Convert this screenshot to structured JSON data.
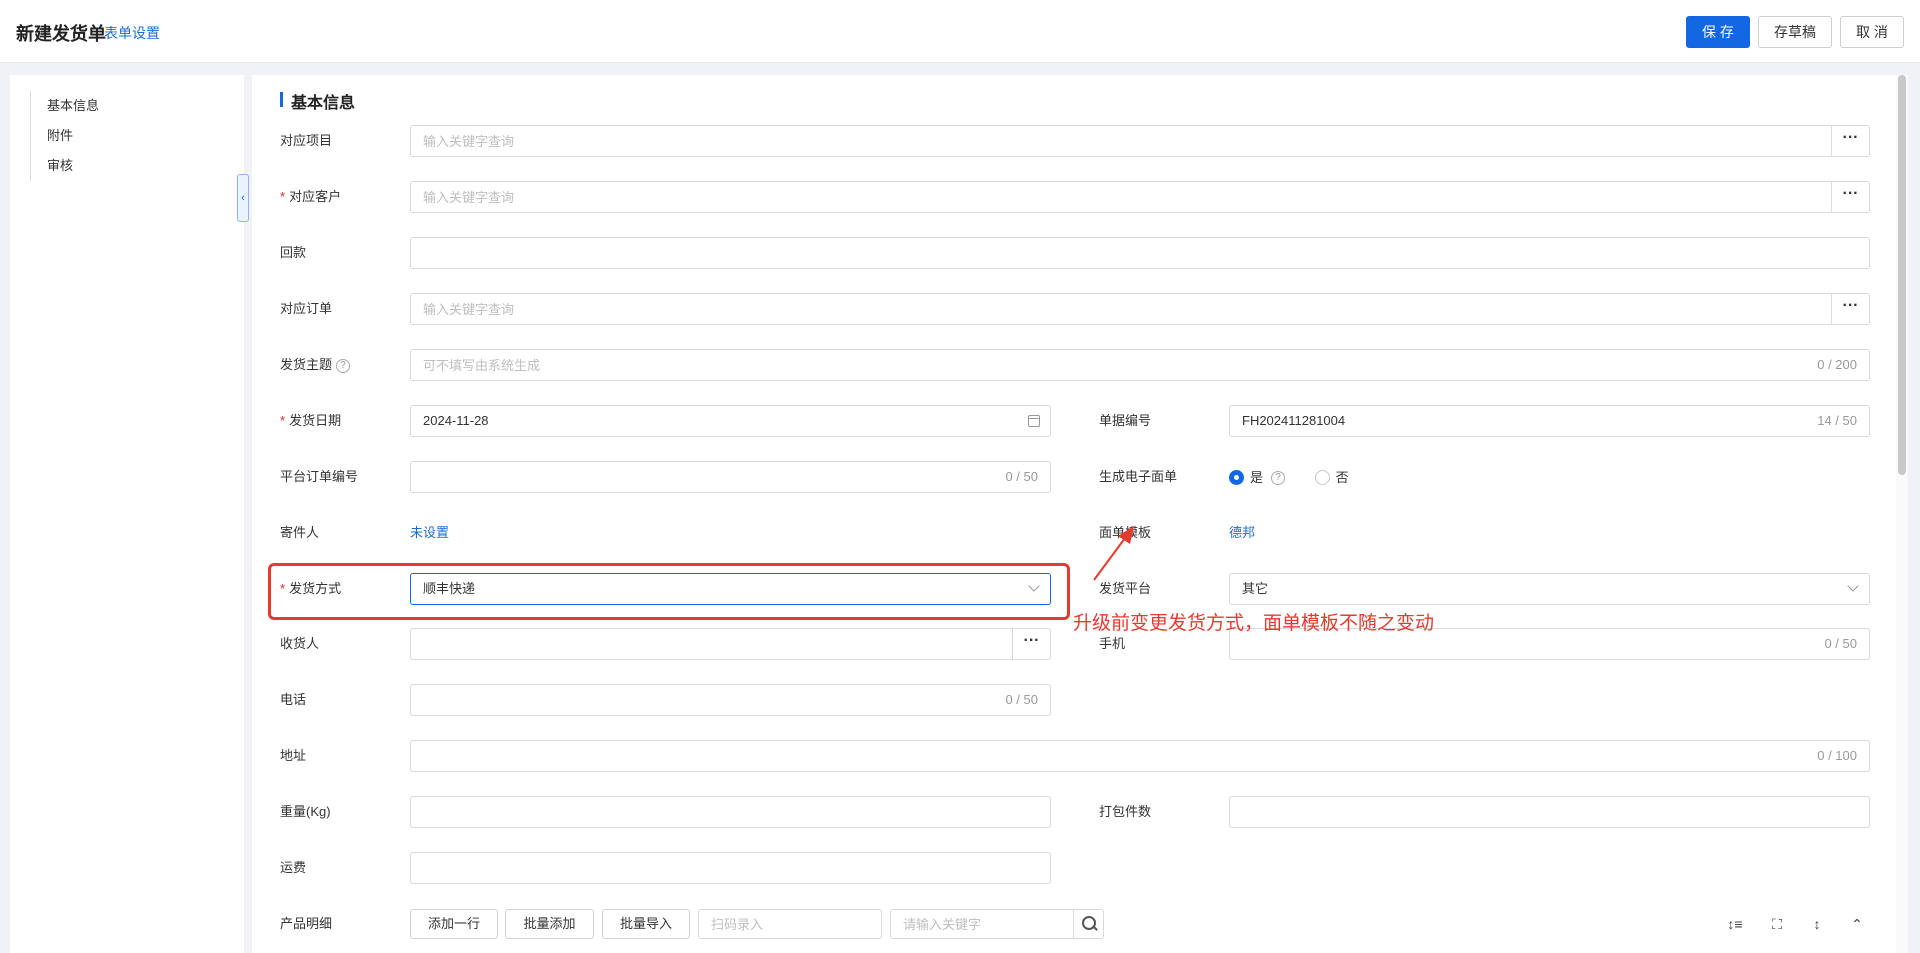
{
  "header": {
    "title": "新建发货单",
    "form_settings": "表单设置",
    "save": "保 存",
    "draft": "存草稿",
    "cancel": "取 消"
  },
  "sidebar": {
    "items": [
      {
        "label": "基本信息"
      },
      {
        "label": "附件"
      },
      {
        "label": "审核"
      }
    ]
  },
  "section": {
    "title": "基本信息"
  },
  "fields": {
    "project": {
      "label": "对应项目",
      "placeholder": "输入关键字查询"
    },
    "customer": {
      "label": "对应客户",
      "placeholder": "输入关键字查询"
    },
    "payment": {
      "label": "回款",
      "value": ""
    },
    "order": {
      "label": "对应订单",
      "placeholder": "输入关键字查询"
    },
    "subject": {
      "label": "发货主题",
      "placeholder": "可不填写由系统生成",
      "counter": "0 / 200"
    },
    "ship_date": {
      "label": "发货日期",
      "value": "2024-11-28"
    },
    "doc_no": {
      "label": "单据编号",
      "value": "FH202411281004",
      "counter": "14 / 50"
    },
    "platform_order": {
      "label": "平台订单编号",
      "counter": "0 / 50"
    },
    "e_waybill": {
      "label": "生成电子面单",
      "yes": "是",
      "no": "否",
      "selected": "是"
    },
    "sender": {
      "label": "寄件人",
      "value": "未设置"
    },
    "waybill_template": {
      "label": "面单模板",
      "value": "德邦"
    },
    "ship_method": {
      "label": "发货方式",
      "value": "顺丰快递"
    },
    "ship_platform": {
      "label": "发货平台",
      "value": "其它"
    },
    "receiver": {
      "label": "收货人",
      "value": ""
    },
    "mobile": {
      "label": "手机",
      "counter": "0 / 50"
    },
    "phone": {
      "label": "电话",
      "counter": "0 / 50"
    },
    "address": {
      "label": "地址",
      "counter": "0 / 100"
    },
    "weight": {
      "label": "重量(Kg)",
      "value": ""
    },
    "package_count": {
      "label": "打包件数",
      "value": ""
    },
    "freight": {
      "label": "运费",
      "value": ""
    }
  },
  "products": {
    "label": "产品明细",
    "add_row": "添加一行",
    "batch_add": "批量添加",
    "batch_import": "批量导入",
    "scan_placeholder": "扫码录入",
    "search_placeholder": "请输入关键字"
  },
  "annotation": {
    "text": "升级前变更发货方式，面单模板不随之变动",
    "color": "#e63a2e"
  },
  "colors": {
    "primary": "#1268e3",
    "link": "#1a6dd8",
    "required": "#e02424"
  }
}
